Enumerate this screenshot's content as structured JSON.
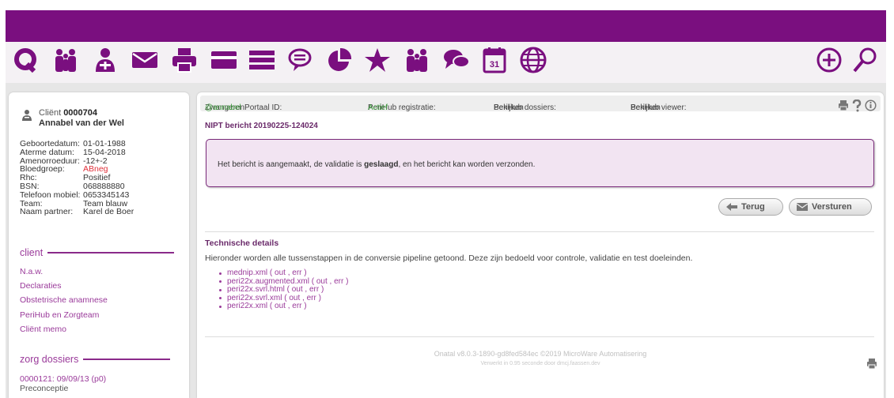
{
  "toolbar": {
    "left_icons": [
      "logo-q-icon",
      "clients-icon",
      "user-add-icon",
      "mail-icon",
      "printer-icon",
      "card-icon",
      "list-icon",
      "chat-icon",
      "pie-chart-icon",
      "star-icon",
      "team-icon",
      "messages-icon",
      "calendar-icon",
      "globe-icon"
    ],
    "calendar_day": "31",
    "right_icons": [
      "add-icon",
      "search-icon"
    ]
  },
  "client": {
    "label": "Cliënt",
    "number": "0000704",
    "name": "Annabel van der Wel",
    "fields": [
      {
        "key": "Geboortedatum:",
        "value": "01-01-1988"
      },
      {
        "key": "Aterme datum:",
        "value": "15-04-2018"
      },
      {
        "key": "Amenorroeduur:",
        "value": "-12+-2"
      },
      {
        "key": "Bloedgroep:",
        "value": "ABneg"
      },
      {
        "key": "Rhc:",
        "value": "Positief"
      },
      {
        "key": "BSN:",
        "value": "068888880"
      },
      {
        "key": "Telefoon mobiel:",
        "value": "0653345143"
      },
      {
        "key": "Team:",
        "value": "Team blauw"
      },
      {
        "key": "Naam partner:",
        "value": "Karel de Boer"
      }
    ]
  },
  "sidebar": {
    "client_section": "client",
    "client_links": [
      "N.a.w.",
      "Declaraties",
      "Obstetrische anamnese",
      "PeriHub en Zorgteam",
      "Cliënt memo"
    ],
    "dossiers_section": "zorg dossiers",
    "dossier_links": [
      "0000121: 09/09/13 (p0)",
      "Preconceptie"
    ]
  },
  "statusbar": {
    "portal_label": "ZwangerenPortaal ID:",
    "portal_value": "@annabel",
    "reg_label": "PeriHub registratie:",
    "reg_value": "Actief",
    "dossiers_label": "PeriHub dossiers:",
    "dossiers_value": "Bekijken",
    "viewer_label": "PeriHub viewer:",
    "viewer_value": "Bekijken"
  },
  "message": {
    "title": "NIPT bericht 20190225-124024",
    "alert_pre": "Het bericht is aangemaakt, de validatie is ",
    "alert_bold": "geslaagd",
    "alert_post": ", en het bericht kan worden verzonden."
  },
  "buttons": {
    "back": "Terug",
    "send": "Versturen"
  },
  "technical": {
    "title": "Technische details",
    "description": "Hieronder worden alle tussenstappen in de conversie pipeline getoond. Deze zijn bedoeld voor controle, validatie en test doeleinden.",
    "files": [
      {
        "name": "mednip.xml",
        "out": "out",
        "err": "err"
      },
      {
        "name": "peri22x.augmented.xml",
        "out": "out",
        "err": "err"
      },
      {
        "name": "peri22x.svrl.html",
        "out": "out",
        "err": "err"
      },
      {
        "name": "peri22x.svrl.xml",
        "out": "out",
        "err": "err"
      },
      {
        "name": "peri22x.xml",
        "out": "out",
        "err": "err"
      }
    ]
  },
  "footer": {
    "line1": "Onatal v8.0.3-1890-gd8fed584ec ©2019 MicroWare Automatisering",
    "line2": "Verwerkt in 0.95 seconde door dmcj.faassen.dev"
  },
  "colors": {
    "brand": "#7a0f7f",
    "link": "#9a3a9a",
    "active": "#3a9a3a",
    "alert_bg": "#f2e4f2"
  }
}
